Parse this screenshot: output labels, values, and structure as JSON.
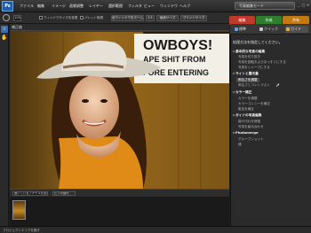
{
  "app": {
    "logo_label": "Ps"
  },
  "menubar": {
    "items": [
      "ファイル",
      "編集",
      "イメージ",
      "画質調整",
      "レイヤー",
      "選択範囲",
      "フィルタ",
      "ビュー",
      "ウィンドウ",
      "ヘルプ"
    ],
    "mode_button": "写真編集モード",
    "window_controls": [
      "_",
      "□",
      "×"
    ]
  },
  "options_bar": {
    "zoom": "100",
    "checkboxes": [
      "ウィンドウサイズを変更",
      "パレット無視"
    ],
    "fit_button": "全ウィンドウをズーム",
    "ratio": "1:1",
    "buttons": [
      "画面サイズ",
      "プリントサイズ"
    ]
  },
  "mode_tabs": [
    {
      "label": "編集",
      "color": "#c0392b"
    },
    {
      "label": "作成",
      "color": "#2f7d2f"
    },
    {
      "label": "共有",
      "color": "#c47a12"
    }
  ],
  "document": {
    "title": "補正後"
  },
  "photo": {
    "sign_lines": [
      "OWBOYS!",
      "APE SHIT FROM",
      "FORE ENTERING"
    ]
  },
  "bin": {
    "dropdown": "開いているファイルを表示",
    "options_button": "ビンの操作"
  },
  "panel": {
    "tabs": [
      "標準",
      "クイック",
      "ガイド"
    ],
    "title": "処理方法を指定してください。",
    "sections": [
      {
        "label": "基本的な写真の編集",
        "items": [
          "写真を切り抜き",
          "写真を回転およびまっすぐにする",
          "写真をシャープにする"
        ]
      },
      {
        "label": "ライトと露光量",
        "items": [
          "明るさを調整",
          "明るさとコントラスト"
        ]
      },
      {
        "label": "カラー補正",
        "items": [
          "カラーを調整",
          "カラーコンシーを補正",
          "肌色を補正"
        ]
      },
      {
        "label": "ガイドの写真編集",
        "items": [
          "傷や汚れを修復",
          "写真を組み合わせ"
        ]
      },
      {
        "label": "Photomerge",
        "items": [
          "グループショット",
          "顔"
        ]
      }
    ],
    "selected_item": "明るさを調整"
  },
  "status": {
    "text": "プロジェクトエリアを隠す"
  }
}
